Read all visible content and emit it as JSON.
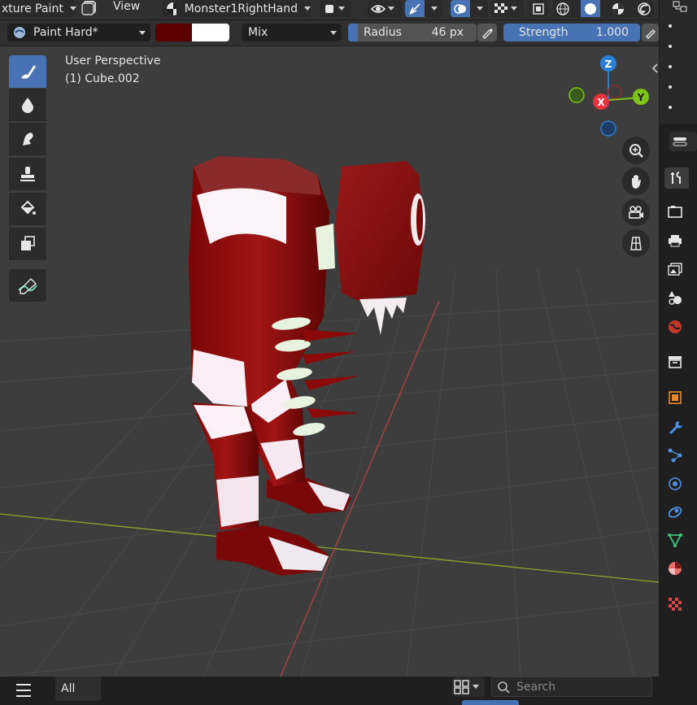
{
  "header": {
    "mode_label": "xture Paint",
    "view_menu": "View",
    "object_name": "Monster1RightHand"
  },
  "tool_settings": {
    "brush_name": "Paint Hard*",
    "color_primary": "#5a0000",
    "color_secondary": "#ffffff",
    "blend_mode": "Mix",
    "radius_label": "Radius",
    "radius_value": "46 px",
    "strength_label": "Strength",
    "strength_value": "1.000"
  },
  "viewport": {
    "perspective_label": "User Perspective",
    "object_label": "(1) Cube.002",
    "gizmo": {
      "z": "Z",
      "x": "X",
      "y": "Y"
    }
  },
  "toolbar": {
    "tools": [
      {
        "name": "draw-tool",
        "icon": "brush-icon",
        "active": true
      },
      {
        "name": "soften-tool",
        "icon": "drop-icon",
        "active": false
      },
      {
        "name": "smear-tool",
        "icon": "smear-icon",
        "active": false
      },
      {
        "name": "clone-tool",
        "icon": "stamp-icon",
        "active": false
      },
      {
        "name": "fill-tool",
        "icon": "bucket-icon",
        "active": false
      },
      {
        "name": "mask-tool",
        "icon": "mask-icon",
        "active": false
      },
      {
        "name": "annotate-tool",
        "icon": "annotate-icon",
        "active": false
      }
    ]
  },
  "bottom": {
    "menu_icon": "hamburger-icon",
    "filter_label": "All",
    "search_placeholder": "Search"
  },
  "colors": {
    "accent": "#4772b3",
    "x_axis": "#e8323e",
    "y_axis": "#7fc21a",
    "z_axis": "#2b7fd4"
  }
}
